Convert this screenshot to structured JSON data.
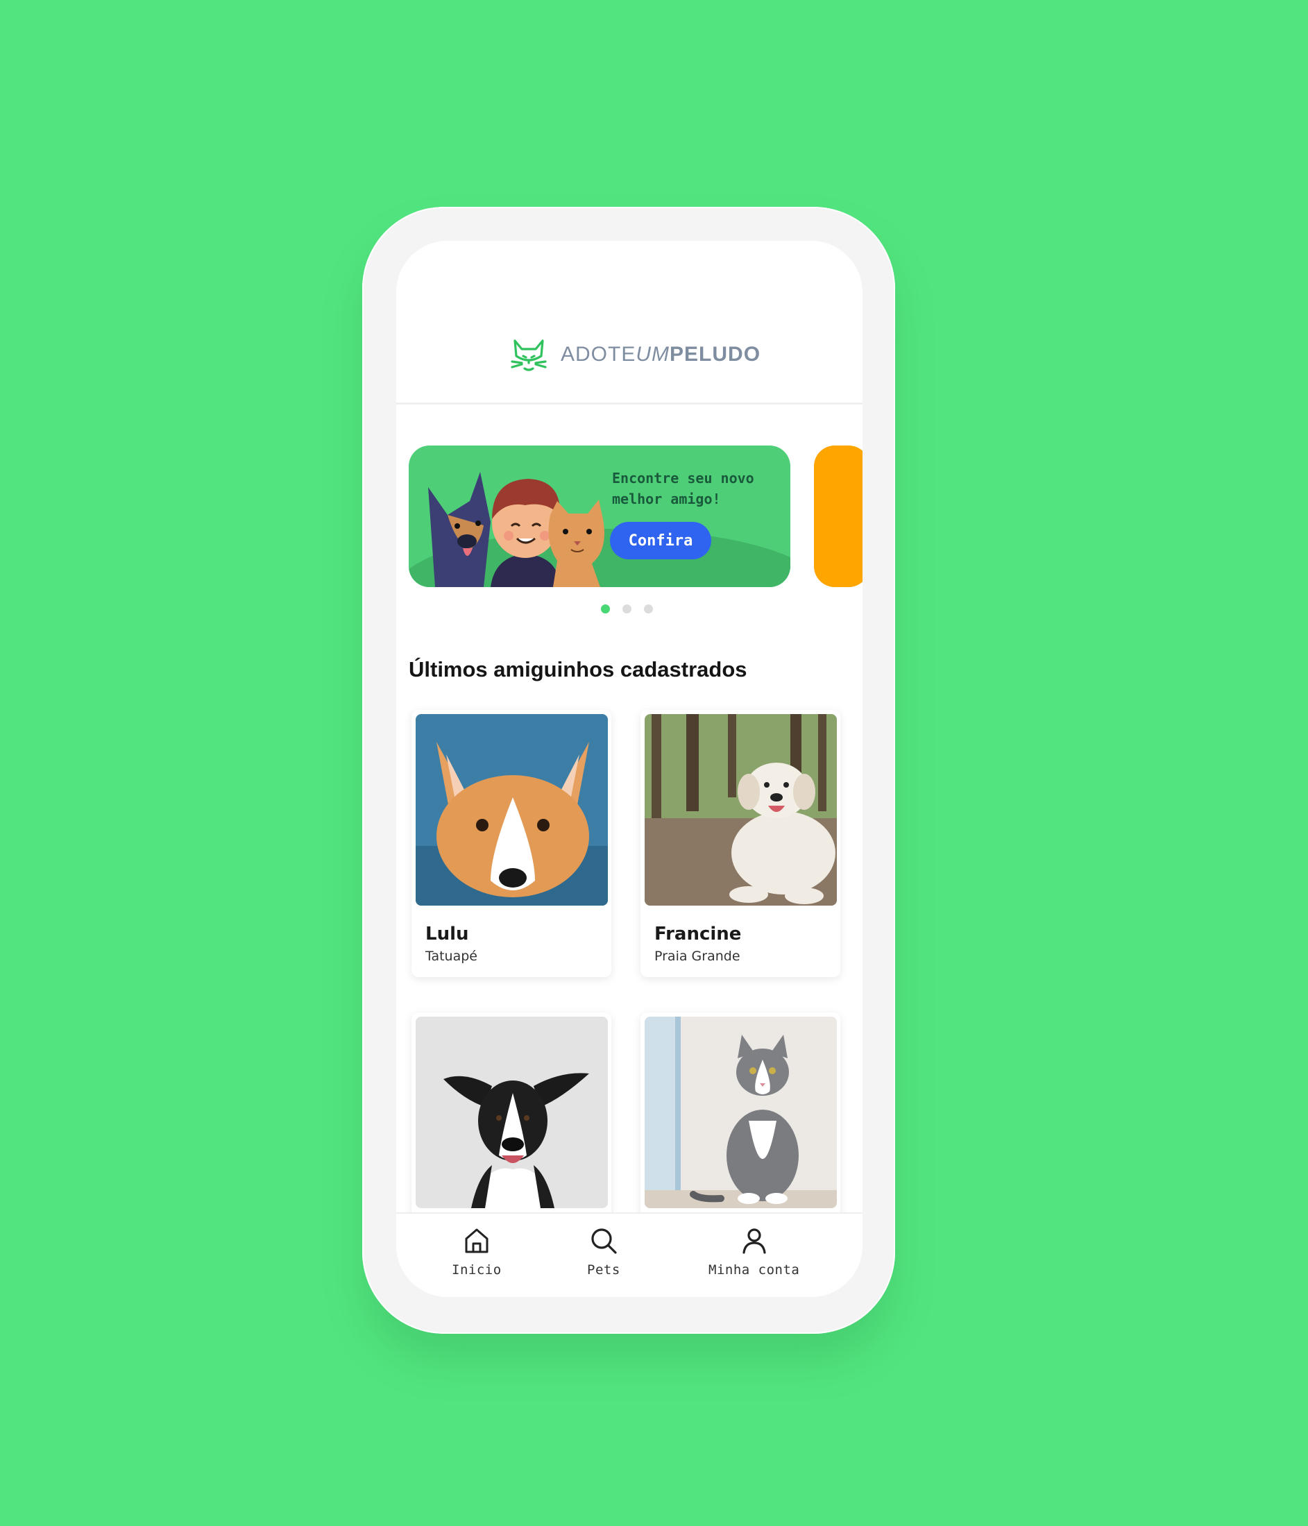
{
  "app": {
    "brand_part1": "ADOTE",
    "brand_part2": "UM",
    "brand_part3": "PELUDO",
    "logo_icon": "cat-face-icon"
  },
  "banner": {
    "headline": "Encontre seu novo melhor amigo!",
    "cta_label": "Confira",
    "slides_total": 3,
    "active_slide": 1
  },
  "section": {
    "title": "Últimos amiguinhos cadastrados"
  },
  "pets": [
    {
      "name": "Lulu",
      "location": "Tatuapé"
    },
    {
      "name": "Francine",
      "location": "Praia Grande"
    },
    {
      "name": "",
      "location": ""
    },
    {
      "name": "",
      "location": ""
    }
  ],
  "tabbar": {
    "items": [
      {
        "label": "Inicio",
        "icon": "home-icon"
      },
      {
        "label": "Pets",
        "icon": "search-icon"
      },
      {
        "label": "Minha conta",
        "icon": "user-icon"
      }
    ]
  },
  "colors": {
    "background": "#52e57f",
    "banner": "#4ecf77",
    "cta": "#2f64f0",
    "next_banner": "#ffa500",
    "brand_icon": "#2fc25d"
  }
}
